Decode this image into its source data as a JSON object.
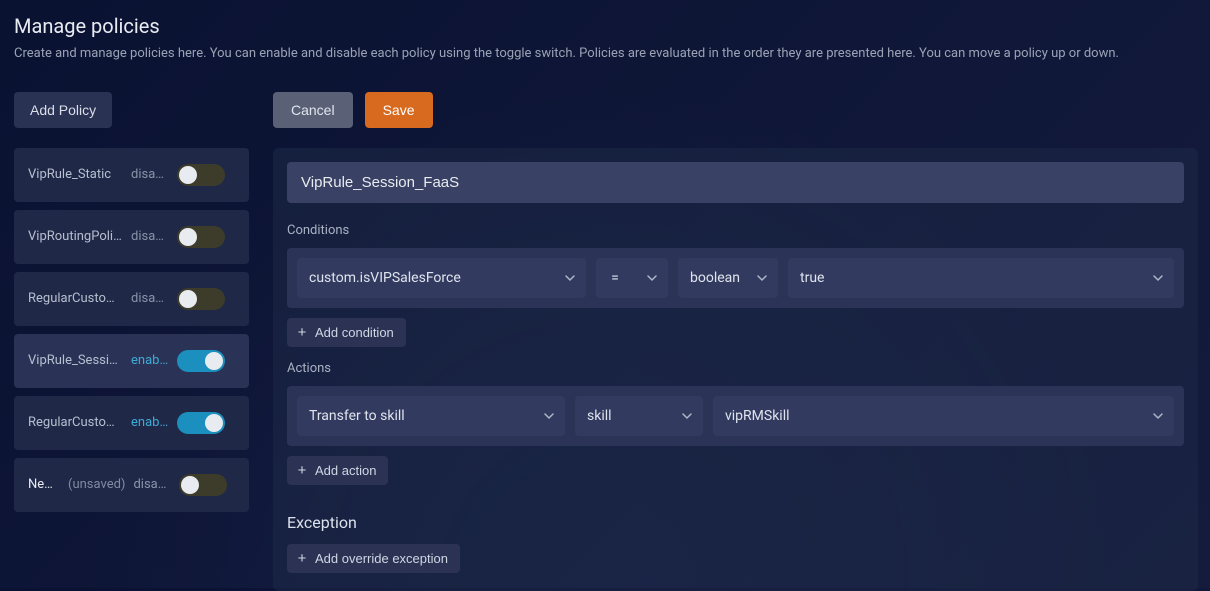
{
  "header": {
    "title": "Manage policies",
    "description": "Create and manage policies here. You can enable and disable each policy using the toggle switch. Policies are evaluated in the order they are presented here. You can move a policy up or down."
  },
  "sidebar": {
    "add_policy_label": "Add Policy",
    "status_enabled": "enabled",
    "status_disabled": "disabled",
    "unsaved_label": "(unsaved)",
    "items": [
      {
        "name": "VipRule_Static",
        "enabled": false,
        "selected": false,
        "unsaved": false
      },
      {
        "name": "VipRoutingPolicy",
        "enabled": false,
        "selected": false,
        "unsaved": false
      },
      {
        "name": "RegularCustomer",
        "enabled": false,
        "selected": false,
        "unsaved": false
      },
      {
        "name": "VipRule_Session_FaaS",
        "enabled": true,
        "selected": true,
        "unsaved": false
      },
      {
        "name": "RegularCustomerRouting",
        "enabled": true,
        "selected": false,
        "unsaved": false
      },
      {
        "name": "New policy",
        "enabled": false,
        "selected": false,
        "unsaved": true
      }
    ]
  },
  "editor": {
    "cancel_label": "Cancel",
    "save_label": "Save",
    "policy_name": "VipRule_Session_FaaS",
    "conditions_label": "Conditions",
    "actions_label": "Actions",
    "exception_label": "Exception",
    "add_condition_label": "Add condition",
    "add_action_label": "Add action",
    "add_exception_label": "Add override exception",
    "condition": {
      "attribute": "custom.isVIPSalesForce",
      "operator": "=",
      "type": "boolean",
      "value": "true"
    },
    "action": {
      "verb": "Transfer to skill",
      "target_type": "skill",
      "target_value": "vipRMSkill"
    }
  }
}
